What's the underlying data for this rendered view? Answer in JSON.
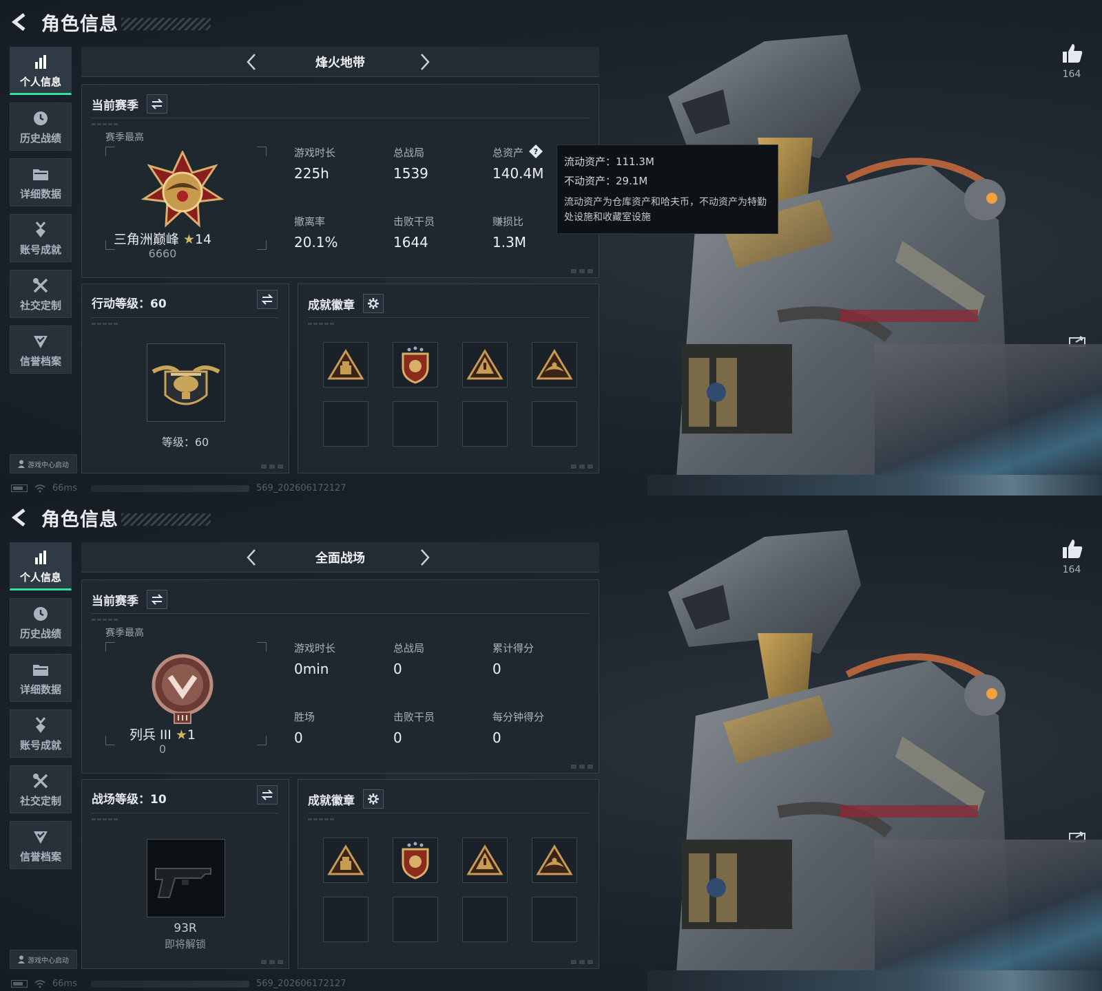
{
  "screens": [
    {
      "header": {
        "title": "角色信息"
      },
      "sidebar": {
        "items": [
          {
            "label": "个人信息",
            "icon": "bar-chart-icon",
            "active": true
          },
          {
            "label": "历史战绩",
            "icon": "clock-icon"
          },
          {
            "label": "详细数据",
            "icon": "folder-icon"
          },
          {
            "label": "账号成就",
            "icon": "medal-icon"
          },
          {
            "label": "社交定制",
            "icon": "tools-icon"
          },
          {
            "label": "信誉档案",
            "icon": "shield-check-icon"
          }
        ],
        "launch_label": "游戏中心启动"
      },
      "status": {
        "ping": "66ms",
        "session": "569_202606172127"
      },
      "mode": {
        "name": "烽火地带"
      },
      "season": {
        "title": "当前赛季",
        "subtitle": "赛季最高",
        "rank_name": "三角洲巅峰",
        "rank_star": "★",
        "rank_stars": "14",
        "rank_score": "6660",
        "stats": [
          {
            "label": "游戏时长",
            "value": "225h"
          },
          {
            "label": "总战局",
            "value": "1539"
          },
          {
            "label": "总资产",
            "value": "140.4M"
          },
          {
            "label": "撤离率",
            "value": "20.1%"
          },
          {
            "label": "击败干员",
            "value": "1644"
          },
          {
            "label": "赚损比",
            "value": "1.3M"
          }
        ]
      },
      "tooltip": {
        "line1": "流动资产：111.3M",
        "line2": "不动资产：29.1M",
        "line3": "流动资产为仓库资产和哈夫币，不动资产为特勤处设施和收藏室设施"
      },
      "level": {
        "title": "行动等级：60",
        "text": "等级：60",
        "sub": ""
      },
      "badges": {
        "title": "成就徽章"
      },
      "likes": {
        "count": "164"
      }
    },
    {
      "header": {
        "title": "角色信息"
      },
      "sidebar": {
        "items": [
          {
            "label": "个人信息",
            "icon": "bar-chart-icon",
            "active": true
          },
          {
            "label": "历史战绩",
            "icon": "clock-icon"
          },
          {
            "label": "详细数据",
            "icon": "folder-icon"
          },
          {
            "label": "账号成就",
            "icon": "medal-icon"
          },
          {
            "label": "社交定制",
            "icon": "tools-icon"
          },
          {
            "label": "信誉档案",
            "icon": "shield-check-icon"
          }
        ],
        "launch_label": "游戏中心启动"
      },
      "status": {
        "ping": "66ms",
        "session": "569_202606172127"
      },
      "mode": {
        "name": "全面战场"
      },
      "season": {
        "title": "当前赛季",
        "subtitle": "赛季最高",
        "rank_name": "列兵 III",
        "rank_star": "★",
        "rank_stars": "1",
        "rank_score": "0",
        "stats": [
          {
            "label": "游戏时长",
            "value": "0min"
          },
          {
            "label": "总战局",
            "value": "0"
          },
          {
            "label": "累计得分",
            "value": "0"
          },
          {
            "label": "胜场",
            "value": "0"
          },
          {
            "label": "击败干员",
            "value": "0"
          },
          {
            "label": "每分钟得分",
            "value": "0"
          }
        ]
      },
      "level": {
        "title": "战场等级：10",
        "text": "93R",
        "sub": "即将解锁"
      },
      "badges": {
        "title": "成就徽章"
      },
      "likes": {
        "count": "164"
      }
    }
  ],
  "colors": {
    "accent": "#2fe0a0",
    "gold": "#d7b35a",
    "panel": "#1f272f"
  }
}
